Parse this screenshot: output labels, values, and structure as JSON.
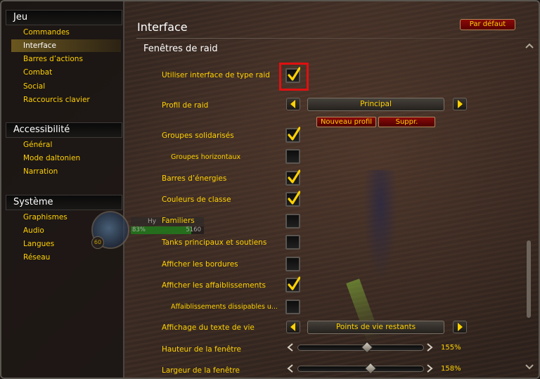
{
  "sidebar": {
    "categories": [
      {
        "header": "Jeu",
        "items": [
          "Commandes",
          "Interface",
          "Barres d’actions",
          "Combat",
          "Social",
          "Raccourcis clavier"
        ]
      },
      {
        "header": "Accessibilité",
        "items": [
          "Général",
          "Mode daltonien",
          "Narration"
        ]
      },
      {
        "header": "Système",
        "items": [
          "Graphismes",
          "Audio",
          "Langues",
          "Réseau"
        ]
      }
    ],
    "active_item": "Interface"
  },
  "unit_frame": {
    "name": "Hy",
    "level": "60",
    "health_percent": "83%",
    "health_value": "5160",
    "health_fraction": 0.83
  },
  "panel": {
    "title": "Interface",
    "default_button": "Par défaut",
    "section_title": "Fenêtres de raid"
  },
  "options": {
    "use_raid_interface": {
      "label": "Utiliser interface de type raid",
      "checked": true
    },
    "raid_profile": {
      "label": "Profil de raid",
      "value": "Principal",
      "new_profile_button": "Nouveau profil",
      "delete_button": "Suppr."
    },
    "keep_groups_together": {
      "label": "Groupes solidarisés",
      "checked": true
    },
    "horizontal_groups": {
      "label": "Groupes horizontaux",
      "checked": false
    },
    "power_bars": {
      "label": "Barres d’énergies",
      "checked": true
    },
    "class_colors": {
      "label": "Couleurs de classe",
      "checked": true
    },
    "pets": {
      "label": "Familiers",
      "checked": false
    },
    "main_tanks": {
      "label": "Tanks principaux et soutiens",
      "checked": false
    },
    "borders": {
      "label": "Afficher les bordures",
      "checked": false
    },
    "debuffs": {
      "label": "Afficher les affaiblissements",
      "checked": true
    },
    "dispellable_debuffs": {
      "label": "Affaiblissements dissipables u...",
      "checked": false
    },
    "health_text": {
      "label": "Affichage du texte de vie",
      "value": "Points de vie restants"
    },
    "frame_height": {
      "label": "Hauteur de la fenêtre",
      "value_text": "155%",
      "fraction": 0.55
    },
    "frame_width": {
      "label": "Largeur de la fenêtre",
      "value_text": "158%",
      "fraction": 0.58
    }
  },
  "colors": {
    "label_gold": "#ffd100",
    "active_highlight": "#aa8c28",
    "focus_outline": "#e01010",
    "button_red": "#8a0a0a"
  },
  "icons": {
    "checkmark": "check-icon",
    "left_arrow": "arrow-left-icon",
    "right_arrow": "arrow-right-icon",
    "scroll_up": "chevron-up-icon",
    "scroll_down": "chevron-down-icon"
  }
}
